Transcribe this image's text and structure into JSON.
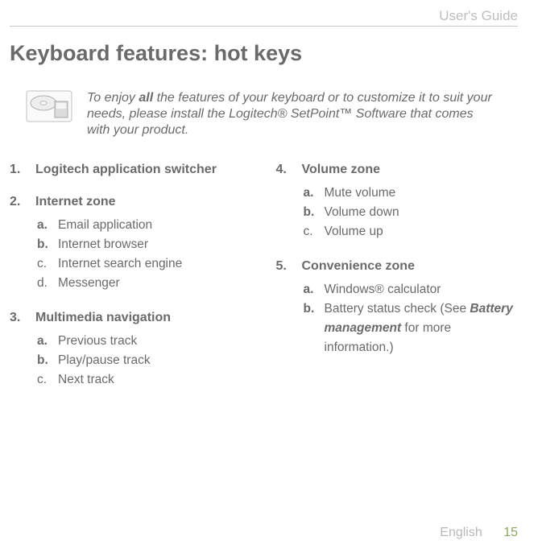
{
  "header": {
    "doc_title": "User's Guide"
  },
  "title": "Keyboard features: hot keys",
  "note": {
    "pre": "To enjoy ",
    "bold": "all",
    "post": " the features of your keyboard or to customize it to suit your needs, please install the Logitech® SetPoint™ Software that comes with your product."
  },
  "sections": [
    {
      "num": "1.",
      "title": "Logitech application switcher",
      "items": []
    },
    {
      "num": "2.",
      "title": "Internet zone",
      "items": [
        {
          "letter": "a.",
          "bold": true,
          "text": "Email application"
        },
        {
          "letter": "b.",
          "bold": true,
          "text": "Internet browser"
        },
        {
          "letter": "c.",
          "bold": false,
          "text": "Internet search engine"
        },
        {
          "letter": "d.",
          "bold": false,
          "text": "Messenger"
        }
      ]
    },
    {
      "num": "3.",
      "title": "Multimedia navigation",
      "items": [
        {
          "letter": "a.",
          "bold": true,
          "text": "Previous track"
        },
        {
          "letter": "b.",
          "bold": true,
          "text": "Play/pause track"
        },
        {
          "letter": "c.",
          "bold": false,
          "text": "Next track"
        }
      ]
    },
    {
      "num": "4.",
      "title": "Volume zone",
      "items": [
        {
          "letter": "a.",
          "bold": true,
          "text": "Mute volume"
        },
        {
          "letter": "b.",
          "bold": true,
          "text": "Volume down"
        },
        {
          "letter": "c.",
          "bold": false,
          "text": "Volume up"
        }
      ]
    },
    {
      "num": "5.",
      "title": "Convenience zone",
      "items": [
        {
          "letter": "a.",
          "bold": true,
          "text": "Windows® calculator"
        },
        {
          "letter": "b.",
          "bold": true,
          "text_pre": "Battery status check (See ",
          "text_bold": "Battery management",
          "text_post": " for more information.)"
        }
      ]
    }
  ],
  "footer": {
    "language": "English",
    "page": "15"
  }
}
